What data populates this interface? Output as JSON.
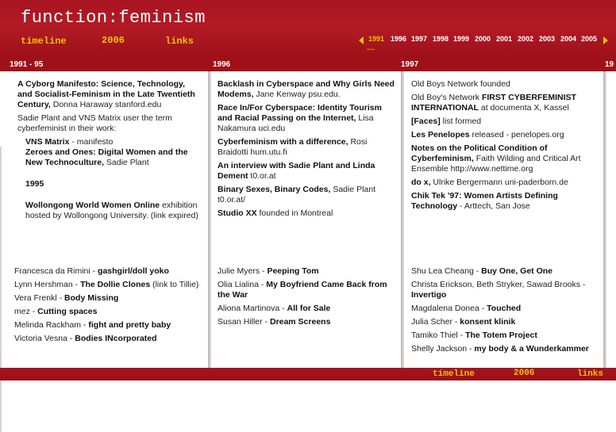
{
  "header": {
    "title": "function:feminism",
    "nav_timeline": "timeline",
    "nav_year": "2006",
    "nav_links": "links",
    "years": [
      "1991",
      "1996",
      "1997",
      "1998",
      "1999",
      "2000",
      "2001",
      "2002",
      "2003",
      "2004",
      "2005"
    ],
    "current_year": "1991"
  },
  "columns": [
    {
      "heading": "1991 - 95",
      "top_items": [
        {
          "bold": "A Cyborg Manifesto: Science, Technology, and Socialist-Feminism in the Late Twentieth Century,",
          "text": " Donna Haraway stanford.edu"
        },
        {
          "bold": "",
          "text": "Sadie Plant and VNS Matrix user the term cyberfeminist in their work:"
        },
        {
          "bold": "VNS Matrix",
          "text": " - manifesto",
          "indent": true
        },
        {
          "bold": "Zeroes and Ones: Digital Women and the New Technoculture,",
          "text": " Sadie Plant",
          "indent": true
        },
        {
          "bold": "1995",
          "text": "",
          "indent": true,
          "gap": true
        },
        {
          "bold": "Wollongong World Women Online",
          "text": " exhibition hosted by Wollongong University. (link expired)",
          "indent": true
        }
      ],
      "bottom_items": [
        {
          "text": "Francesca da Rimini  - ",
          "bold": "gashgirl/doll yoko"
        },
        {
          "text": "Lynn Hershman - ",
          "bold": "The Dollie Clones",
          "after": " (link to Tillie)"
        },
        {
          "text": "Vera Frenkl - ",
          "bold": "Body Missing"
        },
        {
          "text": "mez - ",
          "bold": "Cutting spaces"
        },
        {
          "text": "Melinda Rackham - ",
          "bold": "fight and pretty baby"
        },
        {
          "text": "Victoria Vesna - ",
          "bold": "Bodies INcorporated"
        }
      ]
    },
    {
      "heading": "1996",
      "top_items": [
        {
          "bold": "Backlash in Cyberspace and Why Girls Need Modems,",
          "text": " Jane Kenway psu.edu."
        },
        {
          "bold": "Race In/For Cyberspace: Identity Tourism and Racial Passing on the Internet,",
          "text": " Lisa Nakamura uci.edu"
        },
        {
          "bold": "Cyberfeminism with a difference,",
          "text": " Rosi Braidotti hum.utu.fi"
        },
        {
          "bold": "An interview with Sadie Plant and Linda Dement",
          "text": " t0.or.at"
        },
        {
          "bold": "Binary Sexes, Binary Codes,",
          "text": " Sadie Plant t0.or.at/"
        },
        {
          "bold": "Studio XX",
          "text": " founded in Montreal"
        }
      ],
      "bottom_items": [
        {
          "text": "Julie Myers - ",
          "bold": "Peeping Tom"
        },
        {
          "text": "Olia Lialina - ",
          "bold": "My Boyfriend Came Back from the War"
        },
        {
          "text": "Aliona Martinova - ",
          "bold": "All for Sale"
        },
        {
          "text": "Susan Hiller - ",
          "bold": "Dream Screens"
        }
      ]
    },
    {
      "heading": "1997",
      "top_items": [
        {
          "bold": "",
          "text": "Old Boys Network  founded"
        },
        {
          "bold": "",
          "text": "Old Boy's Network ",
          "bold2": "FIRST CYBERFEMINIST INTERNATIONAL",
          "after": " at documenta X, Kassel"
        },
        {
          "bold": "[Faces]",
          "text": " list formed"
        },
        {
          "bold": "Les Penelopes",
          "text": " released - penelopes.org"
        },
        {
          "bold": "Notes on the Political Condition of Cyberfeminism,",
          "text": " Faith Wilding and Critical Art Ensemble http://www.nettime.org"
        },
        {
          "bold": "do x,",
          "text": " Ulrike Bergermann uni-paderborn.de"
        },
        {
          "bold": "Chik Tek '97: Women Artists Defining Technology",
          "text": "  - Arttech, San Jose"
        }
      ],
      "bottom_items": [
        {
          "text": "Shu Lea Cheang - ",
          "bold": "Buy One, Get One"
        },
        {
          "text": "Christa Erickson, Beth Stryker, Sawad Brooks - ",
          "bold": "Invertigo"
        },
        {
          "text": "Magdalena Donea - ",
          "bold": "Touched"
        },
        {
          "text": "Julia Scher - ",
          "bold": "konsent klinik"
        },
        {
          "text": "Tamiko Thiel - ",
          "bold": "The Totem Project"
        },
        {
          "text": "Shelly Jackson - ",
          "bold": "my body & a Wunderkammer"
        }
      ]
    }
  ],
  "next_heading_partial": "19",
  "footer": {
    "timeline": "timeline",
    "year": "2006",
    "links": "links"
  }
}
